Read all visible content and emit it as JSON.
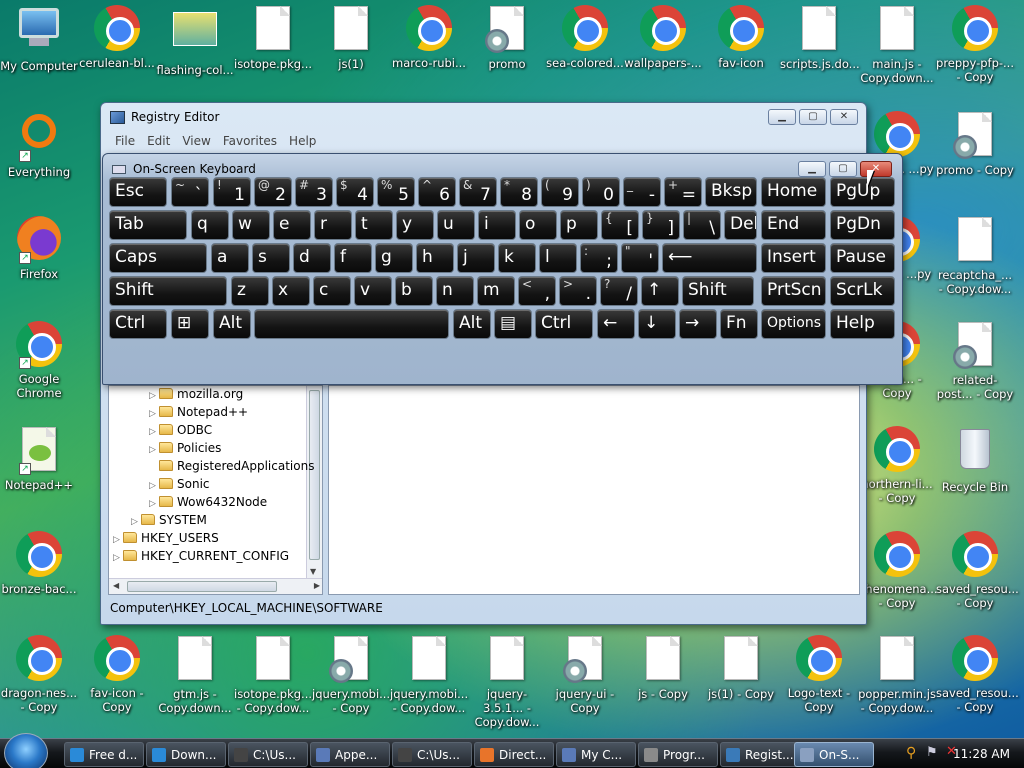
{
  "desktop_icons": [
    {
      "label": "My Computer",
      "kind": "computer"
    },
    {
      "label": "cerulean-bl...",
      "kind": "chrome"
    },
    {
      "label": "flashing-col...",
      "kind": "image"
    },
    {
      "label": "isotope.pkg...",
      "kind": "file"
    },
    {
      "label": "js(1)",
      "kind": "file"
    },
    {
      "label": "marco-rubi...",
      "kind": "chrome"
    },
    {
      "label": "promo",
      "kind": "gear"
    },
    {
      "label": "sea-colored...",
      "kind": "chrome"
    },
    {
      "label": "wallpapers-...",
      "kind": "chrome"
    },
    {
      "label": "fav-icon",
      "kind": "chrome"
    },
    {
      "label": "scripts.js.do...",
      "kind": "file"
    },
    {
      "label": "main.js - Copy.down...",
      "kind": "file"
    },
    {
      "label": "preppy-pfp-... - Copy",
      "kind": "chrome"
    },
    {
      "label": "Everything",
      "kind": "everything"
    },
    {
      "label": "Firefox",
      "kind": "firefox"
    },
    {
      "label": "Google Chrome",
      "kind": "chrome"
    },
    {
      "label": "Notepad++",
      "kind": "notepad"
    },
    {
      "label": "bronze-bac...",
      "kind": "chrome"
    },
    {
      "label": "dragon-nes... - Copy",
      "kind": "chrome"
    },
    {
      "label": "fav-icon - Copy",
      "kind": "chrome"
    },
    {
      "label": "gtm.js - Copy.down...",
      "kind": "file"
    },
    {
      "label": "isotope.pkg... - Copy.dow...",
      "kind": "file"
    },
    {
      "label": "jquery.mobi... - Copy",
      "kind": "gear"
    },
    {
      "label": "jquery.mobi... - Copy.dow...",
      "kind": "file"
    },
    {
      "label": "jquery-3.5.1... - Copy.dow...",
      "kind": "file"
    },
    {
      "label": "jquery-ui - Copy",
      "kind": "gear"
    },
    {
      "label": "js - Copy",
      "kind": "file"
    },
    {
      "label": "js(1) - Copy",
      "kind": "file"
    },
    {
      "label": "Logo-text - Copy",
      "kind": "chrome"
    },
    {
      "label": "popper.min.js - Copy.dow...",
      "kind": "file"
    },
    {
      "label": "saved_resou... - Copy",
      "kind": "chrome"
    },
    {
      "label": "promo - Copy",
      "kind": "gear"
    },
    {
      "label": "recaptcha_... - Copy.dow...",
      "kind": "file"
    },
    {
      "label": "related-post... - Copy",
      "kind": "gear"
    },
    {
      "label": "Recycle Bin",
      "kind": "recycle"
    },
    {
      "label": "saved_resou... - Copy",
      "kind": "chrome"
    },
    {
      "label": "...rubi... ...py",
      "kind": "chrome"
    },
    {
      "label": "...ist-... ...py",
      "kind": "chrome"
    },
    {
      "label": "...win... - Copy",
      "kind": "chrome"
    },
    {
      "label": "northern-li... - Copy",
      "kind": "chrome"
    },
    {
      "label": "phenomena... - Copy",
      "kind": "chrome"
    }
  ],
  "registry_editor": {
    "title": "Registry Editor",
    "menu": [
      "File",
      "Edit",
      "View",
      "Favorites",
      "Help"
    ],
    "tree": [
      {
        "label": "mozilla.org",
        "level": 3,
        "expandable": true
      },
      {
        "label": "Notepad++",
        "level": 3,
        "expandable": true
      },
      {
        "label": "ODBC",
        "level": 3,
        "expandable": true
      },
      {
        "label": "Policies",
        "level": 3,
        "expandable": true
      },
      {
        "label": "RegisteredApplications",
        "level": 3,
        "expandable": false
      },
      {
        "label": "Sonic",
        "level": 3,
        "expandable": true
      },
      {
        "label": "Wow6432Node",
        "level": 3,
        "expandable": true
      },
      {
        "label": "SYSTEM",
        "level": 2,
        "expandable": true
      },
      {
        "label": "HKEY_USERS",
        "level": 1,
        "expandable": true
      },
      {
        "label": "HKEY_CURRENT_CONFIG",
        "level": 1,
        "expandable": true
      }
    ],
    "status_path": "Computer\\HKEY_LOCAL_MACHINE\\SOFTWARE"
  },
  "osk": {
    "title": "On-Screen Keyboard",
    "rows": [
      [
        {
          "label": "Esc"
        },
        {
          "shift": "~",
          "main": "`"
        },
        {
          "shift": "!",
          "main": "1"
        },
        {
          "shift": "@",
          "main": "2"
        },
        {
          "shift": "#",
          "main": "3"
        },
        {
          "shift": "$",
          "main": "4"
        },
        {
          "shift": "%",
          "main": "5"
        },
        {
          "shift": "^",
          "main": "6"
        },
        {
          "shift": "&",
          "main": "7"
        },
        {
          "shift": "*",
          "main": "8"
        },
        {
          "shift": "(",
          "main": "9"
        },
        {
          "shift": ")",
          "main": "0"
        },
        {
          "shift": "_",
          "main": "-"
        },
        {
          "shift": "+",
          "main": "="
        },
        {
          "label": "Bksp"
        },
        {
          "label": "Home"
        },
        {
          "label": "PgUp"
        }
      ],
      [
        {
          "label": "Tab"
        },
        {
          "label": "q"
        },
        {
          "label": "w"
        },
        {
          "label": "e"
        },
        {
          "label": "r"
        },
        {
          "label": "t"
        },
        {
          "label": "y"
        },
        {
          "label": "u"
        },
        {
          "label": "i"
        },
        {
          "label": "o"
        },
        {
          "label": "p"
        },
        {
          "shift": "{",
          "main": "["
        },
        {
          "shift": "}",
          "main": "]"
        },
        {
          "shift": "|",
          "main": "\\"
        },
        {
          "label": "Del"
        },
        {
          "label": "End"
        },
        {
          "label": "PgDn"
        }
      ],
      [
        {
          "label": "Caps"
        },
        {
          "label": "a"
        },
        {
          "label": "s"
        },
        {
          "label": "d"
        },
        {
          "label": "f"
        },
        {
          "label": "g"
        },
        {
          "label": "h"
        },
        {
          "label": "j"
        },
        {
          "label": "k"
        },
        {
          "label": "l"
        },
        {
          "shift": ":",
          "main": ";"
        },
        {
          "shift": "\"",
          "main": "'"
        },
        {
          "label": "⟵"
        },
        {
          "label": "Insert"
        },
        {
          "label": "Pause"
        }
      ],
      [
        {
          "label": "Shift"
        },
        {
          "label": "z"
        },
        {
          "label": "x"
        },
        {
          "label": "c"
        },
        {
          "label": "v"
        },
        {
          "label": "b"
        },
        {
          "label": "n"
        },
        {
          "label": "m"
        },
        {
          "shift": "<",
          "main": ","
        },
        {
          "shift": ">",
          "main": "."
        },
        {
          "shift": "?",
          "main": "/"
        },
        {
          "label": "↑"
        },
        {
          "label": "Shift"
        },
        {
          "label": "PrtScn"
        },
        {
          "label": "ScrLk"
        }
      ],
      [
        {
          "label": "Ctrl"
        },
        {
          "label": "⊞"
        },
        {
          "label": "Alt"
        },
        {
          "label": ""
        },
        {
          "label": "Alt"
        },
        {
          "label": "▤"
        },
        {
          "label": "Ctrl"
        },
        {
          "label": "←"
        },
        {
          "label": "↓"
        },
        {
          "label": "→"
        },
        {
          "label": "Fn"
        },
        {
          "label": "Options"
        },
        {
          "label": "Help"
        }
      ]
    ]
  },
  "taskbar": {
    "buttons": [
      {
        "label": "Free d...",
        "color": "#2a8ad8"
      },
      {
        "label": "Down...",
        "color": "#2a8ad8"
      },
      {
        "label": "C:\\Us...",
        "color": "#444"
      },
      {
        "label": "Appe...",
        "color": "#5a7ab8"
      },
      {
        "label": "C:\\Us...",
        "color": "#444"
      },
      {
        "label": "Direct...",
        "color": "#e8742a"
      },
      {
        "label": "My C...",
        "color": "#5a7ab8"
      },
      {
        "label": "Progr...",
        "color": "#8a8a8a"
      },
      {
        "label": "Regist...",
        "color": "#3a7ab8"
      },
      {
        "label": "On-S...",
        "color": "#8aa0c0"
      }
    ],
    "clock": "11:28 AM"
  }
}
